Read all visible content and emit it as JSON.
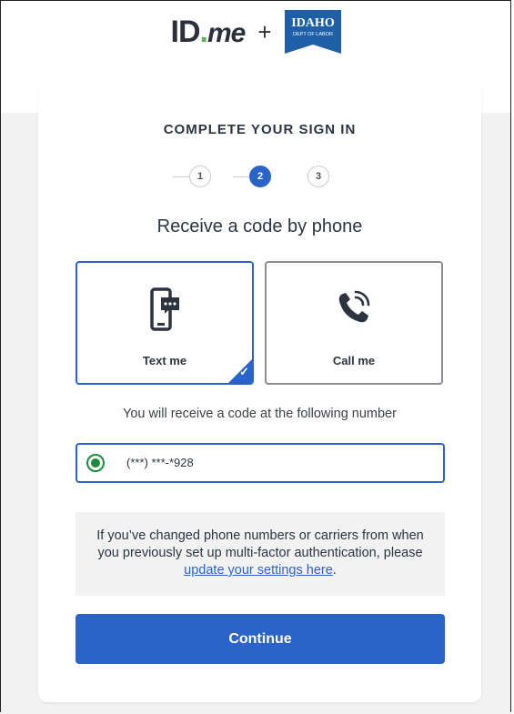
{
  "header": {
    "idme_logo": {
      "id": "ID",
      "dot": ".",
      "me": "me"
    },
    "plus": "+",
    "partner_logo": {
      "line1": "IDAHO",
      "line2": "DEPT OF LABOR"
    }
  },
  "card": {
    "title": "COMPLETE YOUR SIGN IN",
    "steps": [
      {
        "label": "1",
        "state": "inactive"
      },
      {
        "label": "2",
        "state": "active"
      },
      {
        "label": "3",
        "state": "inactive"
      }
    ],
    "subtitle": "Receive a code by phone",
    "options": [
      {
        "label": "Text me",
        "icon": "phone-message-icon",
        "selected": true
      },
      {
        "label": "Call me",
        "icon": "phone-call-icon",
        "selected": false
      }
    ],
    "info_text": "You will receive a code at the following number",
    "phone_number": "(***) ***-*928",
    "notice": {
      "text_before": "If you’ve changed phone numbers or carriers from when you previously set up multi-factor authentication, please ",
      "link_text": "update your settings here",
      "text_after": "."
    },
    "continue_label": "Continue"
  },
  "colors": {
    "primary": "#2b64c9",
    "radio_green": "#1f8a3c",
    "idme_green": "#57b559",
    "idaho_blue": "#1f5fa8"
  }
}
